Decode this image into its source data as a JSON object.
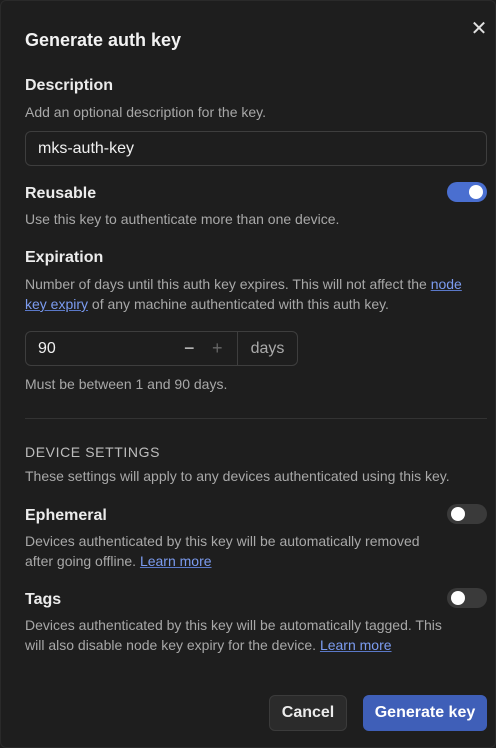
{
  "dialog": {
    "title": "Generate auth key",
    "close_icon": "close-icon"
  },
  "description": {
    "label": "Description",
    "help": "Add an optional description for the key.",
    "value": "mks-auth-key"
  },
  "reusable": {
    "label": "Reusable",
    "help": "Use this key to authenticate more than one device.",
    "enabled": true
  },
  "expiration": {
    "label": "Expiration",
    "help_pre": "Number of days until this auth key expires. This will not affect the ",
    "help_link": "node key expiry",
    "help_post": " of any machine authenticated with this auth key.",
    "value": "90",
    "minus": "−",
    "plus": "+",
    "unit": "days",
    "hint": "Must be between 1 and 90 days."
  },
  "device_settings": {
    "heading": "DEVICE SETTINGS",
    "help": "These settings will apply to any devices authenticated using this key."
  },
  "ephemeral": {
    "label": "Ephemeral",
    "help": "Devices authenticated by this key will be automatically removed after going offline. ",
    "link": "Learn more",
    "enabled": false
  },
  "tags": {
    "label": "Tags",
    "help": "Devices authenticated by this key will be automatically tagged. This will also disable node key expiry for the device. ",
    "link": "Learn more",
    "enabled": false
  },
  "footer": {
    "cancel": "Cancel",
    "generate": "Generate key"
  },
  "colors": {
    "accent": "#4a6fd0",
    "button": "#3f5fb8",
    "background": "#1e1e1e"
  }
}
